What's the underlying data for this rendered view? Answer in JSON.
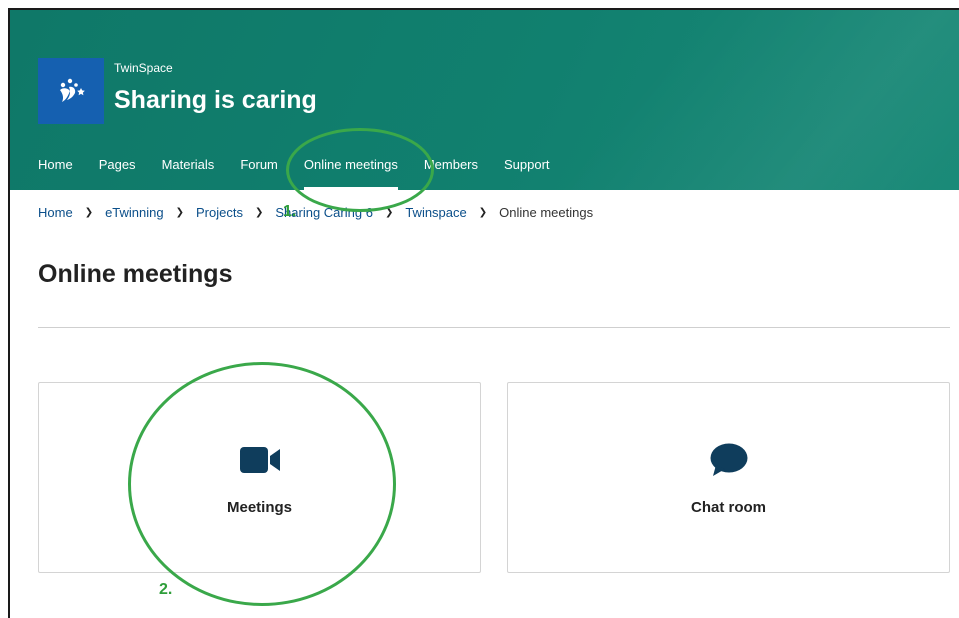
{
  "header": {
    "eyebrow": "TwinSpace",
    "title": "Sharing is caring",
    "logo_icon": "etwinning-stars-icon",
    "background_color": "#11806f",
    "logo_background_color": "#1560b0"
  },
  "nav": {
    "items": [
      {
        "label": "Home"
      },
      {
        "label": "Pages"
      },
      {
        "label": "Materials"
      },
      {
        "label": "Forum"
      },
      {
        "label": "Online meetings"
      },
      {
        "label": "Members"
      },
      {
        "label": "Support"
      }
    ],
    "active": "Online meetings"
  },
  "breadcrumb": {
    "items": [
      {
        "label": "Home"
      },
      {
        "label": "eTwinning"
      },
      {
        "label": "Projects"
      },
      {
        "label": "Sharing Caring 6"
      },
      {
        "label": "Twinspace"
      },
      {
        "label": "Online meetings"
      }
    ],
    "separator_icon": "chevron-right-icon"
  },
  "page": {
    "title": "Online meetings"
  },
  "cards": [
    {
      "label": "Meetings",
      "icon": "video-camera-icon"
    },
    {
      "label": "Chat room",
      "icon": "speech-bubble-icon"
    }
  ],
  "annotations": {
    "step1": "1.",
    "step2": "2.",
    "color": "#3aa84a"
  }
}
